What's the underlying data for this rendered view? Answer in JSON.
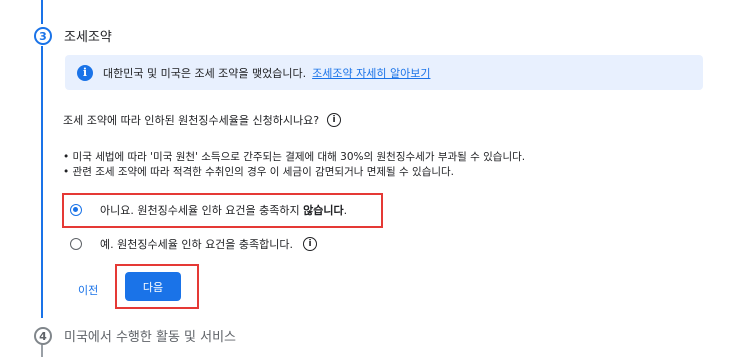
{
  "step3": {
    "number": "3",
    "title": "조세조약"
  },
  "info": {
    "icon": "i",
    "text": "대한민국 및 미국은 조세 조약을 맺었습니다.",
    "link": "조세조약 자세히 알아보기"
  },
  "question": {
    "text": "조세 조약에 따라 인하된 원천징수세율을 신청하시나요?",
    "help_icon": "i"
  },
  "bullets": [
    "미국 세법에 따라 '미국 원천' 소득으로 간주되는 결제에 대해 30%의 원천징수세가 부과될 수 있습니다.",
    "관련 조세 조약에 따라 적격한 수취인의 경우 이 세금이 감면되거나 면제될 수 있습니다."
  ],
  "options": {
    "no": {
      "prefix": "아니요. 원천징수세율 인하 요건을 충족하지 ",
      "bold": "않습니다",
      "suffix": ".",
      "selected": true
    },
    "yes": {
      "label": "예. 원천징수세율 인하 요건을 충족합니다.",
      "selected": false
    }
  },
  "buttons": {
    "prev": "이전",
    "next": "다음"
  },
  "step4": {
    "number": "4",
    "title": "미국에서 수행한 활동 및 서비스"
  },
  "colors": {
    "accent": "#1a73e8",
    "highlight": "#e53935",
    "info_bg": "#e8f0fe"
  }
}
